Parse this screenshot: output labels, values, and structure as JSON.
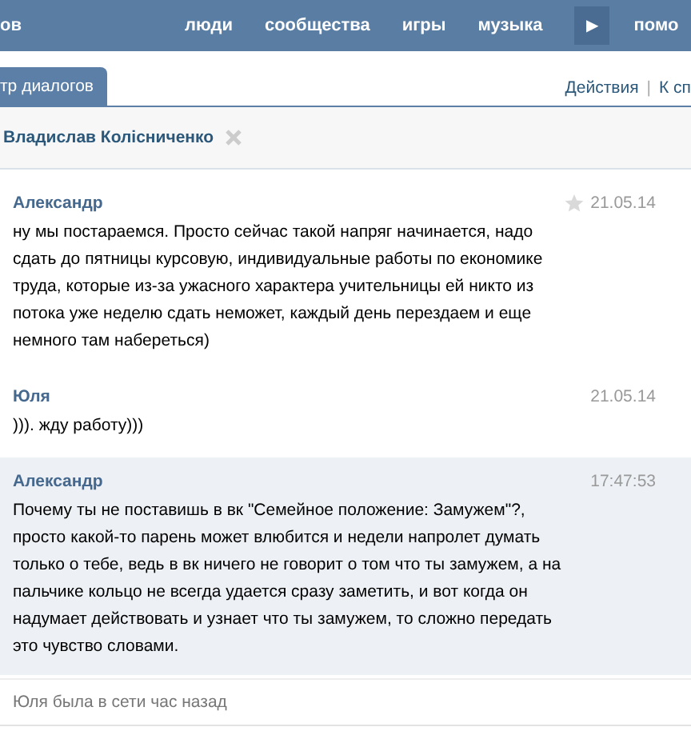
{
  "top_nav": {
    "items": [
      "ов",
      "люди",
      "сообщества",
      "игры",
      "музыка"
    ],
    "more_button": "▶",
    "cut_item": "помо"
  },
  "tabs": [
    {
      "label": "тр диалогов",
      "selected": true
    }
  ],
  "actions": [
    "Действия",
    "К сп"
  ],
  "actions_separator": "|",
  "dialog": {
    "title": "Владислав Колісниченко"
  },
  "messages": [
    {
      "author": "Александр",
      "time": "21.05.14",
      "starred": false,
      "unread": false,
      "text": "ну мы постараемся. Просто сейчас такой напряг начинается, надо сдать до пятницы курсовую, индивидуальные работы по економике труда, которые из-за ужасного характера учительницы ей никто из потока уже неделю сдать неможет, каждый день перездаем и еще немного там набереться)"
    },
    {
      "author": "Юля",
      "time": "21.05.14",
      "unread": false,
      "text": "))). жду работу)))"
    },
    {
      "author": "Александр",
      "time": "17:47:53",
      "unread": true,
      "text": "Почему ты не поставишь в вк \"Семейное положение: Замужем\"?, просто какой-то парень может влюбится и недели напролет думать только о тебе, ведь в вк ничего не говорит о том что ты замужем, а на пальчике кольцо не всегда удается сразу заметить, и вот когда он надумает действовать и узнает что ты замужем, то сложно передать это чувство словами."
    }
  ],
  "status": "Юля была в сети час назад"
}
